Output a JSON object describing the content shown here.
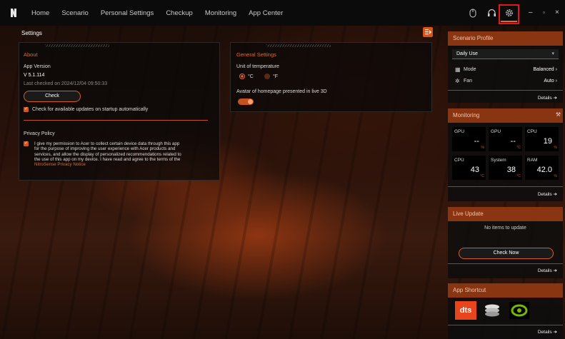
{
  "nav": {
    "items": [
      "Home",
      "Scenario",
      "Personal Settings",
      "Checkup",
      "Monitoring",
      "App Center"
    ]
  },
  "page": {
    "title": "Settings"
  },
  "about": {
    "title": "About",
    "app_version_label": "App Version",
    "version": "V 5.1.114",
    "last_checked": "Last checked on 2024/12/04 09:50:33",
    "check_button": "Check",
    "auto_update_label": "Check for available updates on startup automatically",
    "privacy_title": "Privacy Policy",
    "privacy_text_lines": [
      "I give my permission to Acer to collect certain device data through this app",
      "for the purpose of improving the user experience with Acer products and",
      "services, and allow the display of personalized recommendations related to",
      "the use of this app on my device. I have read and agree to the terms of the"
    ],
    "privacy_link": "NitroSense Privacy Notice"
  },
  "general": {
    "title": "General Settings",
    "unit_label": "Unit of temperature",
    "celsius": "°C",
    "fahrenheit": "°F",
    "avatar_label": "Avatar of homepage presented in live 3D",
    "avatar_toggle": true
  },
  "scenario": {
    "title": "Scenario Profile",
    "selected": "Daily Use",
    "mode_label": "Mode",
    "mode_value": "Balanced",
    "fan_label": "Fan",
    "fan_value": "Auto",
    "details": "Details"
  },
  "monitoring": {
    "title": "Monitoring",
    "cells": [
      {
        "label": "GPU",
        "value": "--",
        "unit": "%"
      },
      {
        "label": "GPU",
        "value": "--",
        "unit": "°C"
      },
      {
        "label": "CPU",
        "value": "19",
        "unit": "%"
      },
      {
        "label": "CPU",
        "value": "43",
        "unit": "°C"
      },
      {
        "label": "System",
        "value": "38",
        "unit": "°C"
      },
      {
        "label": "RAM",
        "value": "42.0",
        "unit": "%"
      }
    ],
    "details": "Details"
  },
  "live_update": {
    "title": "Live Update",
    "empty": "No items to update",
    "button": "Check Now",
    "details": "Details"
  },
  "app_shortcut": {
    "title": "App Shortcut",
    "apps": [
      "dts-icon",
      "disk-icon",
      "nvidia-icon"
    ],
    "dts_text": "dts",
    "details": "Details"
  },
  "colors": {
    "accent": "#e36a2a",
    "header": "#8a3512",
    "highlight": "#e0181a"
  }
}
